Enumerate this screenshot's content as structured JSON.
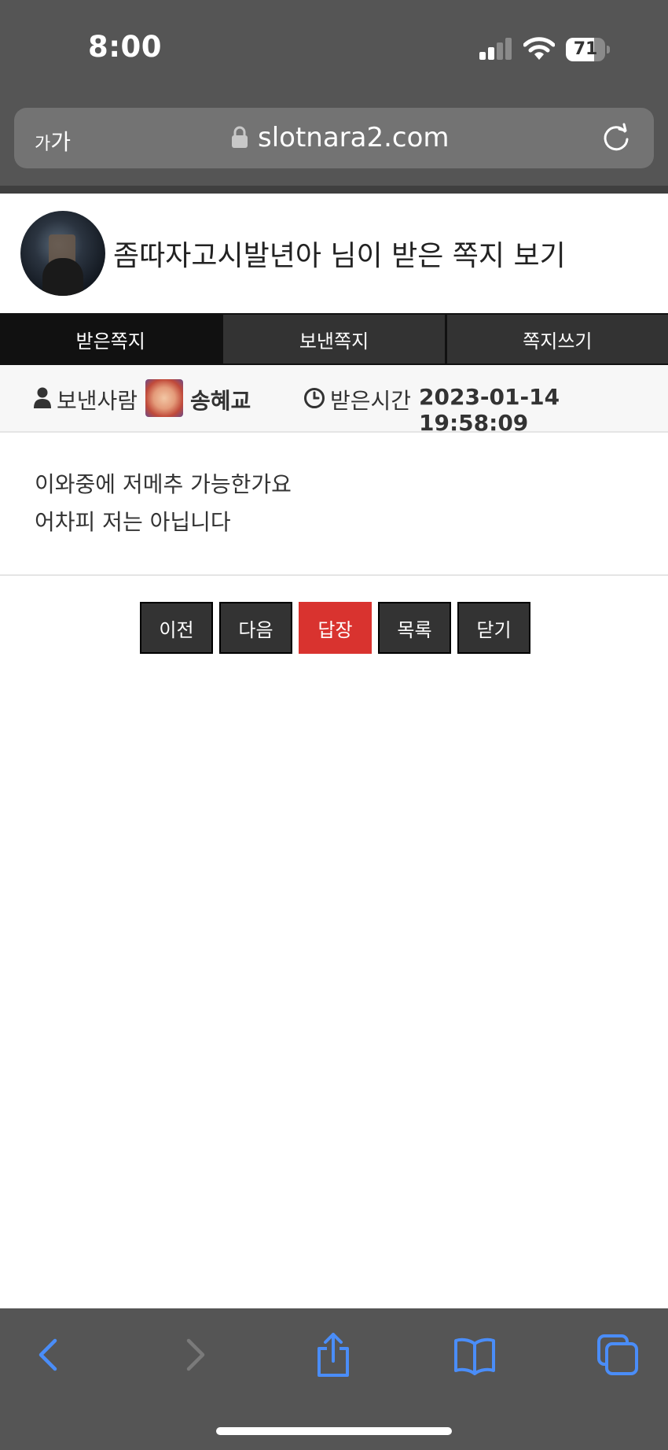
{
  "status_bar": {
    "time": "8:00",
    "battery": "71",
    "battery_level": 0.71
  },
  "url_bar": {
    "text_size_small": "가",
    "text_size_large": "가",
    "url": "slotnara2.com"
  },
  "page": {
    "title": "좀따자고시발년아 님이 받은 쪽지 보기",
    "tabs": [
      {
        "label": "받은쪽지",
        "active": true
      },
      {
        "label": "보낸쪽지",
        "active": false
      },
      {
        "label": "쪽지쓰기",
        "active": false
      }
    ],
    "info": {
      "sender_label": "보낸사람",
      "sender_name": "송혜교",
      "received_label": "받은시간",
      "received_time": "2023-01-14 19:58:09"
    },
    "message_lines": [
      "이와중에 저메추 가능한가요",
      "어차피 저는 아닙니다"
    ],
    "buttons": {
      "prev": "이전",
      "next": "다음",
      "reply": "답장",
      "list": "목록",
      "close": "닫기"
    }
  },
  "colors": {
    "chrome": "#555555",
    "reply_button": "#d9332f",
    "dark_button": "#333333",
    "toolbar_icon_active": "#4a8df8",
    "toolbar_icon_disabled": "#7a7a7a"
  },
  "toolbar": {
    "icons": [
      "back-icon",
      "forward-icon",
      "share-icon",
      "bookmarks-icon",
      "tabs-icon"
    ]
  }
}
